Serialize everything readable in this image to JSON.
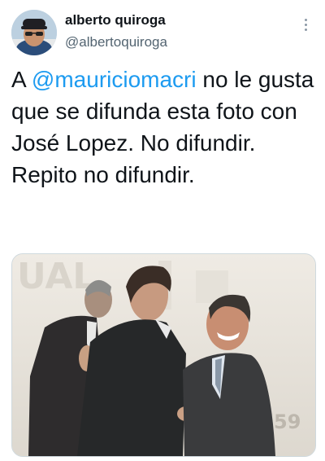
{
  "tweet": {
    "author": {
      "display_name": "alberto quiroga",
      "handle": "@albertoquiroga",
      "avatar_icon": "profile-photo"
    },
    "more_icon": "more-vertical-icon",
    "text_before": "A ",
    "mention": "@mauriciomacri",
    "text_after": " no le gusta que se difunda esta foto con José Lopez. No difundir. Repito no difundir.",
    "media": {
      "type": "photo",
      "backdrop_text": "UAL",
      "corner_logo_text": "59"
    }
  },
  "colors": {
    "link": "#1d9bf0",
    "secondary_text": "#536471",
    "text": "#0f1419"
  }
}
